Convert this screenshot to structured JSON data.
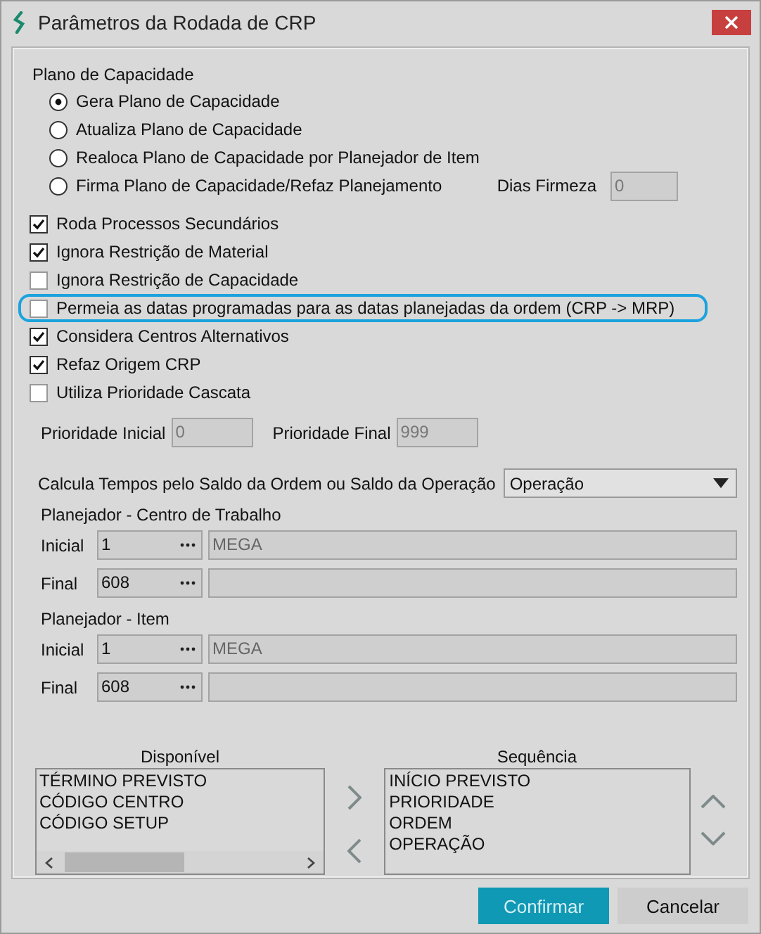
{
  "window": {
    "title": "Parâmetros da Rodada de CRP"
  },
  "capacity_plan": {
    "label": "Plano de Capacidade",
    "options": [
      {
        "label": "Gera Plano de Capacidade",
        "selected": true
      },
      {
        "label": "Atualiza Plano de Capacidade",
        "selected": false
      },
      {
        "label": "Realoca Plano de Capacidade por Planejador de Item",
        "selected": false
      },
      {
        "label": "Firma Plano de Capacidade/Refaz Planejamento",
        "selected": false
      }
    ]
  },
  "firm_days": {
    "label": "Dias Firmeza",
    "value": "0",
    "disabled": true
  },
  "options": [
    {
      "label": "Roda Processos Secundários",
      "checked": true,
      "highlighted": false
    },
    {
      "label": "Ignora Restrição de Material",
      "checked": true,
      "highlighted": false
    },
    {
      "label": "Ignora Restrição de Capacidade",
      "checked": false,
      "highlighted": false
    },
    {
      "label": "Permeia as datas programadas para as datas planejadas da ordem (CRP -> MRP)",
      "checked": false,
      "highlighted": true
    },
    {
      "label": "Considera Centros Alternativos",
      "checked": true,
      "highlighted": false
    },
    {
      "label": "Refaz Origem CRP",
      "checked": true,
      "highlighted": false
    },
    {
      "label": "Utiliza Prioridade Cascata",
      "checked": false,
      "highlighted": false
    }
  ],
  "priority": {
    "initial": {
      "label": "Prioridade Inicial",
      "value": "0",
      "disabled": true
    },
    "final": {
      "label": "Prioridade Final",
      "value": "999",
      "disabled": true
    }
  },
  "calc": {
    "label": "Calcula Tempos pelo Saldo da Ordem ou Saldo da Operação",
    "value": "Operação"
  },
  "planner_groups": [
    {
      "title": "Planejador - Centro de Trabalho",
      "rows": [
        {
          "label": "Inicial",
          "code": "1",
          "description": "MEGA"
        },
        {
          "label": "Final",
          "code": "608"
        }
      ]
    },
    {
      "title": "Planejador - Item",
      "rows": [
        {
          "label": "Inicial",
          "code": "1",
          "description": "MEGA"
        },
        {
          "label": "Final",
          "code": "608"
        }
      ]
    }
  ],
  "available": {
    "title": "Disponível",
    "items": [
      "TÉRMINO PREVISTO",
      "CÓDIGO CENTRO",
      "CÓDIGO SETUP"
    ]
  },
  "sequence": {
    "title": "Sequência",
    "items": [
      "INÍCIO PREVISTO",
      "PRIORIDADE",
      "ORDEM",
      "OPERAÇÃO"
    ]
  },
  "buttons": [
    {
      "label": "Confirmar",
      "primary": true
    },
    {
      "label": "Cancelar",
      "primary": false
    }
  ]
}
